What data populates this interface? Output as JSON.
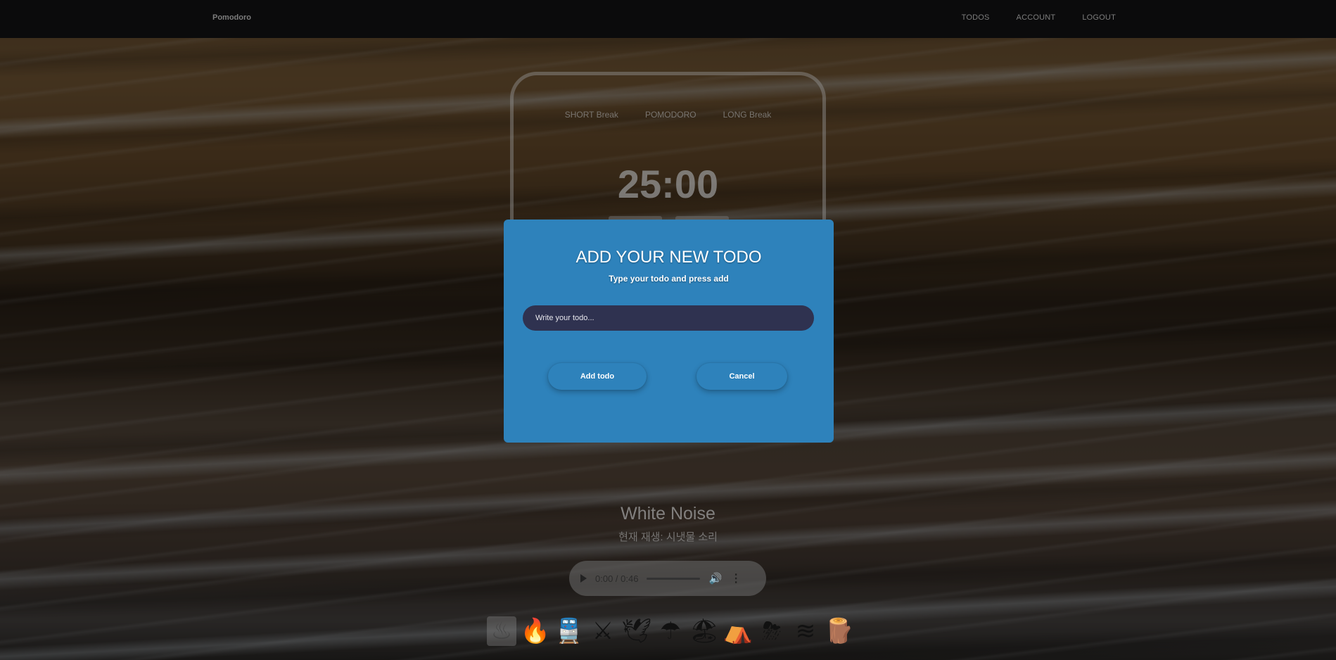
{
  "navbar": {
    "brand": "Pomodoro",
    "links": [
      "TODOS",
      "ACCOUNT",
      "LOGOUT"
    ]
  },
  "timer": {
    "tabs": [
      "SHORT Break",
      "POMODORO",
      "LONG Break"
    ],
    "display": "25:00"
  },
  "white_noise": {
    "title": "White Noise",
    "subtitle": "현재 재생: 시냇물 소리",
    "player": {
      "time": "0:00 / 0:46"
    },
    "sounds": [
      {
        "name": "stream",
        "glyph": "♨"
      },
      {
        "name": "campfire",
        "glyph": "🔥"
      },
      {
        "name": "train",
        "glyph": "🚆"
      },
      {
        "name": "swords",
        "glyph": "⚔"
      },
      {
        "name": "bird",
        "glyph": "🕊"
      },
      {
        "name": "umbrella",
        "glyph": "☂"
      },
      {
        "name": "beach",
        "glyph": "🏖"
      },
      {
        "name": "camping",
        "glyph": "⛺"
      },
      {
        "name": "storm",
        "glyph": "⛈"
      },
      {
        "name": "waves",
        "glyph": "≋"
      },
      {
        "name": "wood",
        "glyph": "🪵"
      }
    ]
  },
  "modal": {
    "title": "ADD YOUR NEW TODO",
    "subtitle": "Type your todo and press add",
    "input_placeholder": "Write your todo...",
    "input_value": "",
    "add_label": "Add todo",
    "cancel_label": "Cancel",
    "color": "#2e82bb"
  }
}
